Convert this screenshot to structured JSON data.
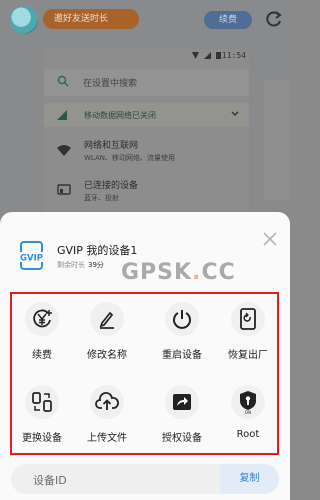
{
  "app": {
    "promo_label": "邀好友送时长",
    "renew_label": "续费"
  },
  "phone_screen": {
    "status_time": "11:54",
    "search_placeholder": "在设置中搜索",
    "mobile_data_text": "移动数据网络已关闭",
    "rows": [
      {
        "title": "网络和互联网",
        "subtitle": "WLAN、移动网络、流量使用"
      },
      {
        "title": "已连接的设备",
        "subtitle": "蓝牙、投射"
      }
    ]
  },
  "sheet": {
    "device_name": "GVIP 我的设备1",
    "device_badge": "GVIP",
    "remaining_label": "剩余时长",
    "remaining_value": "39分",
    "actions": [
      {
        "label": "续费",
        "icon": "yuan-plus-icon"
      },
      {
        "label": "修改名称",
        "icon": "pencil-icon"
      },
      {
        "label": "重启设备",
        "icon": "power-icon"
      },
      {
        "label": "恢复出厂",
        "icon": "factory-reset-icon"
      },
      {
        "label": "更换设备",
        "icon": "swap-device-icon"
      },
      {
        "label": "上传文件",
        "icon": "cloud-upload-icon"
      },
      {
        "label": "授权设备",
        "icon": "share-authorize-icon"
      },
      {
        "label": "Root",
        "icon": "root-shield-icon"
      }
    ],
    "root_badge": "ON",
    "device_id_label": "设备ID",
    "copy_label": "复制"
  },
  "watermark": {
    "text_left": "GPSK",
    "dot": ".",
    "text_right": "CC"
  },
  "colors": {
    "accent_blue": "#2f7fd6",
    "frame_red": "#e0201c",
    "promo_brown": "#a8632b"
  }
}
